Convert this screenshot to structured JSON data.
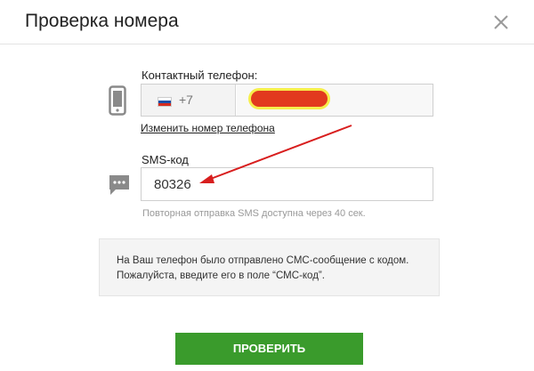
{
  "dialog": {
    "title": "Проверка номера"
  },
  "phone": {
    "label": "Контактный телефон:",
    "country_flag": "russia-flag",
    "dial_code": "+7",
    "number_value": "",
    "change_link": "Изменить номер телефона"
  },
  "sms": {
    "label": "SMS-код",
    "value": "80326",
    "resend_note": "Повторная отправка SMS доступна через 40 сек."
  },
  "info": {
    "text": "На Ваш телефон было отправлено СМС-сообщение с кодом. Пожалуйста, введите его в поле “СМС-код”."
  },
  "actions": {
    "verify_label": "ПРОВЕРИТЬ"
  },
  "colors": {
    "accent_green": "#3a9b2c",
    "annotation_red": "#d81e1e",
    "icon_gray": "#8a8a8a"
  },
  "icons": {
    "close": "close-icon",
    "phone": "mobile-phone-icon",
    "sms": "chat-bubble-icon"
  }
}
